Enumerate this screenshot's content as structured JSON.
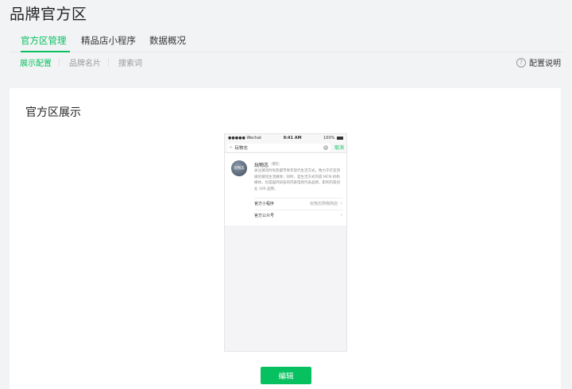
{
  "page": {
    "title": "品牌官方区"
  },
  "tabs": [
    {
      "label": "官方区管理",
      "active": true
    },
    {
      "label": "精品店小程序",
      "active": false
    },
    {
      "label": "数据概况",
      "active": false
    }
  ],
  "subtabs": [
    {
      "label": "展示配置",
      "active": true
    },
    {
      "label": "品牌名片",
      "active": false
    },
    {
      "label": "搜索词",
      "active": false
    }
  ],
  "help": {
    "label": "配置说明",
    "icon": "question-circle-icon"
  },
  "panel": {
    "title": "官方区展示"
  },
  "preview": {
    "status": {
      "carrier": "●●●●● Wechat",
      "time": "9:41 AM",
      "battery": "100%"
    },
    "search": {
      "query": "玩物志",
      "cancel": "取消"
    },
    "brand": {
      "avatar_text": "玩物志",
      "name": "玩物志",
      "tag": "官方",
      "description": "关注潮流时尚及都市青年现代生活方式，致力于打造顶级的潮流生活媒体；同时，是生活方式内容 MCN 机构媒体，也是国内知名的内容电商代表品牌，影响内容创业 100 品牌。"
    },
    "rows": [
      {
        "label": "官方小程序",
        "value": "玩物志购物商店"
      },
      {
        "label": "官方公众号",
        "value": ""
      }
    ]
  },
  "actions": {
    "edit_label": "编辑"
  },
  "colors": {
    "accent": "#07c160",
    "background": "#f2f3f5"
  }
}
